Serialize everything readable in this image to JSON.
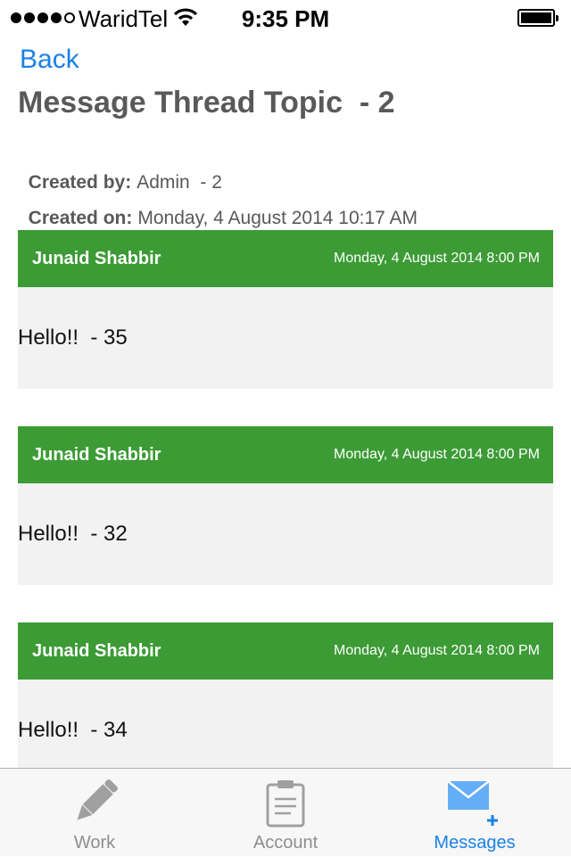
{
  "status_bar": {
    "carrier": "WaridTel",
    "time": "9:35 PM",
    "signal_bars_filled": 4,
    "signal_bars_total": 5
  },
  "nav": {
    "back_label": "Back"
  },
  "thread": {
    "title": "Message Thread Topic  - 2",
    "created_by_label": "Created by:",
    "created_by_value": "Admin  - 2",
    "created_on_label": "Created on:",
    "created_on_value": "Monday, 4 August 2014 10:17 AM"
  },
  "messages": [
    {
      "author": "Junaid Shabbir",
      "date": "Monday, 4 August 2014 8:00 PM",
      "body": "Hello!!  - 35"
    },
    {
      "author": "Junaid Shabbir",
      "date": "Monday, 4 August 2014 8:00 PM",
      "body": "Hello!!  - 32"
    },
    {
      "author": "Junaid Shabbir",
      "date": "Monday, 4 August 2014 8:00 PM",
      "body": "Hello!!  - 34"
    }
  ],
  "tab_bar": {
    "tabs": [
      {
        "label": "Work",
        "icon": "pencil-icon",
        "active": false
      },
      {
        "label": "Account",
        "icon": "clipboard-icon",
        "active": false
      },
      {
        "label": "Messages",
        "icon": "envelope-plus-icon",
        "active": true
      }
    ]
  },
  "colors": {
    "accent": "#1a82e6",
    "message_header": "#3c9b35",
    "message_body": "#f2f2f2",
    "inactive_tab": "#8e8e8e"
  }
}
